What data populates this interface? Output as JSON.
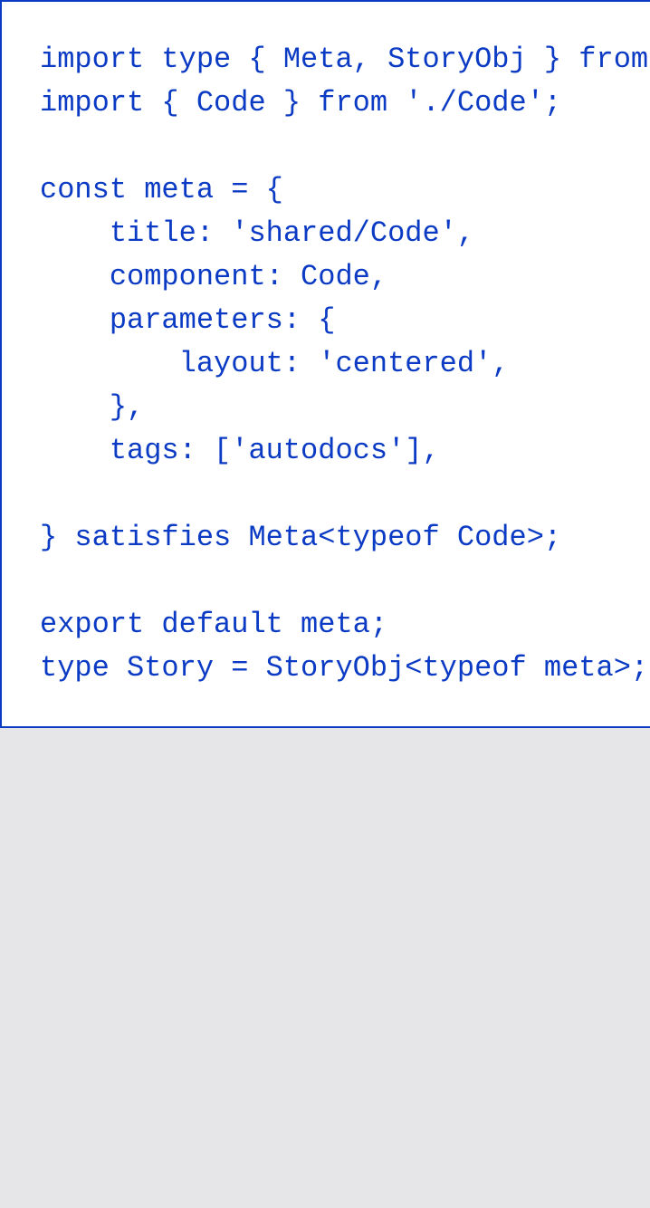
{
  "code": {
    "lines": [
      "import type { Meta, StoryObj } from '@storybook/react';",
      "import { Code } from './Code';",
      "",
      "const meta = {",
      "    title: 'shared/Code',",
      "    component: Code,",
      "    parameters: {",
      "        layout: 'centered',",
      "    },",
      "    tags: ['autodocs'],",
      "",
      "} satisfies Meta<typeof Code>;",
      "",
      "export default meta;",
      "type Story = StoryObj<typeof meta>;"
    ],
    "text_color": "#0b3bc4",
    "border_color": "#0b3bc4",
    "panel_background": "#ffffff",
    "page_background": "#e6e6e8"
  }
}
